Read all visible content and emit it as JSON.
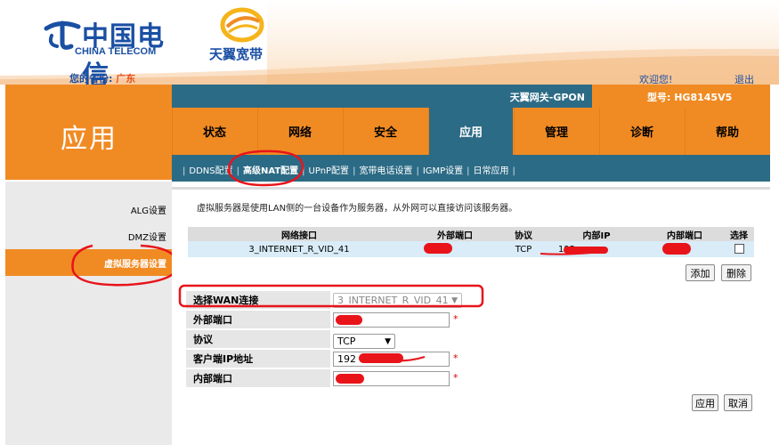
{
  "header": {
    "brand_cn": "中国电信",
    "brand_en": "CHINA TELECOM",
    "brand2": "天翼宽带",
    "province_label": "您的省份:",
    "province_value": "广东",
    "welcome": "欢迎您!",
    "logout": "退出"
  },
  "app_title": "应用",
  "device": {
    "name": "天翼网关-GPON",
    "model": "型号: HG8145V5"
  },
  "nav": [
    {
      "label": "状态"
    },
    {
      "label": "网络"
    },
    {
      "label": "安全"
    },
    {
      "label": "应用"
    },
    {
      "label": "管理"
    },
    {
      "label": "诊断"
    },
    {
      "label": "帮助"
    }
  ],
  "subnav": [
    {
      "label": "DDNS配置"
    },
    {
      "label": "高级NAT配置"
    },
    {
      "label": "UPnP配置"
    },
    {
      "label": "宽带电话设置"
    },
    {
      "label": "IGMP设置"
    },
    {
      "label": "日常应用"
    }
  ],
  "sidebar": [
    {
      "label": "ALG设置"
    },
    {
      "label": "DMZ设置"
    },
    {
      "label": "虚拟服务器设置"
    }
  ],
  "main": {
    "description": "虚拟服务器是使用LAN侧的一台设备作为服务器，从外网可以直接访问该服务器。",
    "table": {
      "headers": [
        "网络接口",
        "外部端口",
        "协议",
        "内部IP",
        "内部端口",
        "选择"
      ],
      "row": {
        "interface": "3_INTERNET_R_VID_41",
        "protocol": "TCP",
        "ip_prefix": "192"
      }
    },
    "add_button": "添加",
    "delete_button": "删除",
    "form": {
      "wan_label": "选择WAN连接",
      "wan_value": "3_INTERNET_R_VID_41",
      "ext_port_label": "外部端口",
      "protocol_label": "协议",
      "protocol_value": "TCP",
      "client_ip_label": "客户端IP地址",
      "client_ip_prefix": "192",
      "int_port_label": "内部端口",
      "required_mark": "*"
    },
    "apply_button": "应用",
    "cancel_button": "取消"
  },
  "colors": {
    "orange": "#f08b24",
    "teal": "#2c6b85",
    "blue": "#1a4fa3",
    "redact": "#e8141a"
  }
}
